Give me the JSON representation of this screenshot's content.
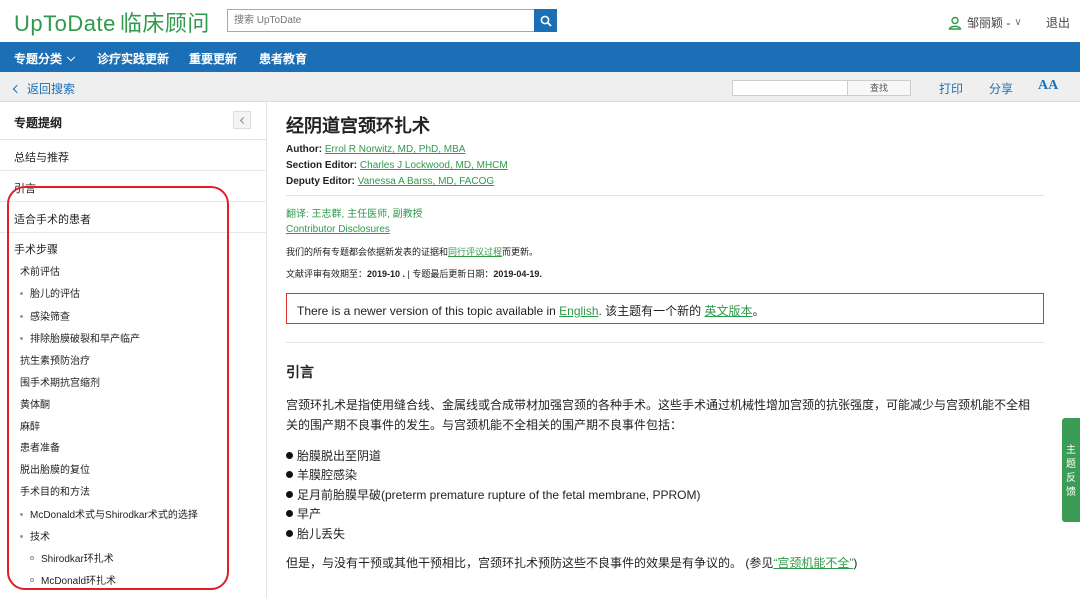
{
  "header": {
    "logo_text": "UpToDate",
    "logo_cn": "临床顾问",
    "search_placeholder": "搜索 UpToDate",
    "user_name": "邹丽颖 -",
    "logout": "退出"
  },
  "nav": {
    "items": [
      "专题分类",
      "诊疗实践更新",
      "重要更新",
      "患者教育"
    ]
  },
  "subbar": {
    "back": "返回搜索",
    "find_button": "查找",
    "print": "打印",
    "share": "分享",
    "text_size": "AA"
  },
  "sidebar": {
    "title": "专题提纲",
    "rows": [
      "总结与推荐",
      "引言",
      "适合手术的患者"
    ],
    "section": "手术步骤",
    "items": [
      {
        "label": "术前评估"
      },
      {
        "label": "胎儿的评估"
      },
      {
        "label": "感染筛查"
      },
      {
        "label": "排除胎膜破裂和早产临产"
      },
      {
        "label": "抗生素预防治疗"
      },
      {
        "label": "围手术期抗宫缩剂"
      },
      {
        "label": "黄体酮"
      },
      {
        "label": "麻醉"
      },
      {
        "label": "患者准备"
      },
      {
        "label": "脱出胎膜的复位"
      },
      {
        "label": "手术目的和方法"
      },
      {
        "label": "McDonald术式与Shirodkar术式的选择"
      },
      {
        "label": "技术"
      },
      {
        "label": "Shirodkar环扎术"
      },
      {
        "label": "McDonald环扎术"
      }
    ]
  },
  "article": {
    "title": "经阴道宫颈环扎术",
    "author_label": "Author:",
    "author": "Errol R Norwitz, MD, PhD, MBA",
    "section_editor_label": "Section Editor:",
    "section_editor": "Charles J Lockwood, MD, MHCM",
    "deputy_editor_label": "Deputy Editor:",
    "deputy_editor": "Vanessa A Barss, MD, FACOG",
    "translation": "翻译: 王志群, 主任医师, 副教授",
    "disclosures": "Contributor Disclosures",
    "update_note_pre": "我们的所有专题都会依据新发表的证据和",
    "update_note_link": "同行评议过程",
    "update_note_post": "而更新。",
    "review_label": "文献评审有效期至：",
    "review_date": "2019-10 .",
    "update_label": " | 专题最后更新日期：",
    "update_date": "2019-04-19.",
    "notice_pre": "There is a newer version of this topic available in ",
    "notice_link1": "English",
    "notice_mid": ". 该主题有一个新的 ",
    "notice_link2": "英文版本",
    "notice_post": "。",
    "section_title": "引言",
    "intro_para": "宫颈环扎术是指使用缝合线、金属线或合成带材加强宫颈的各种手术。这些手术通过机械性增加宫颈的抗张强度，可能减少与宫颈机能不全相关的围产期不良事件的发生。与宫颈机能不全相关的围产期不良事件包括：",
    "bullets": [
      "胎膜脱出至阴道",
      "羊膜腔感染",
      "足月前胎膜早破(preterm premature rupture of the fetal membrane, PPROM)",
      "早产",
      "胎儿丢失"
    ],
    "closing_pre": "但是，与没有干预或其他干预相比，宫颈环扎术预防这些不良事件的效果是有争议的。 (参见",
    "closing_link": "“宫颈机能不全”",
    "closing_post": ")"
  },
  "feedback": "主题反馈",
  "colors": {
    "brand_green": "#2e9a4a",
    "nav_blue": "#1b6fb6",
    "annotation_red": "#e41e25"
  }
}
